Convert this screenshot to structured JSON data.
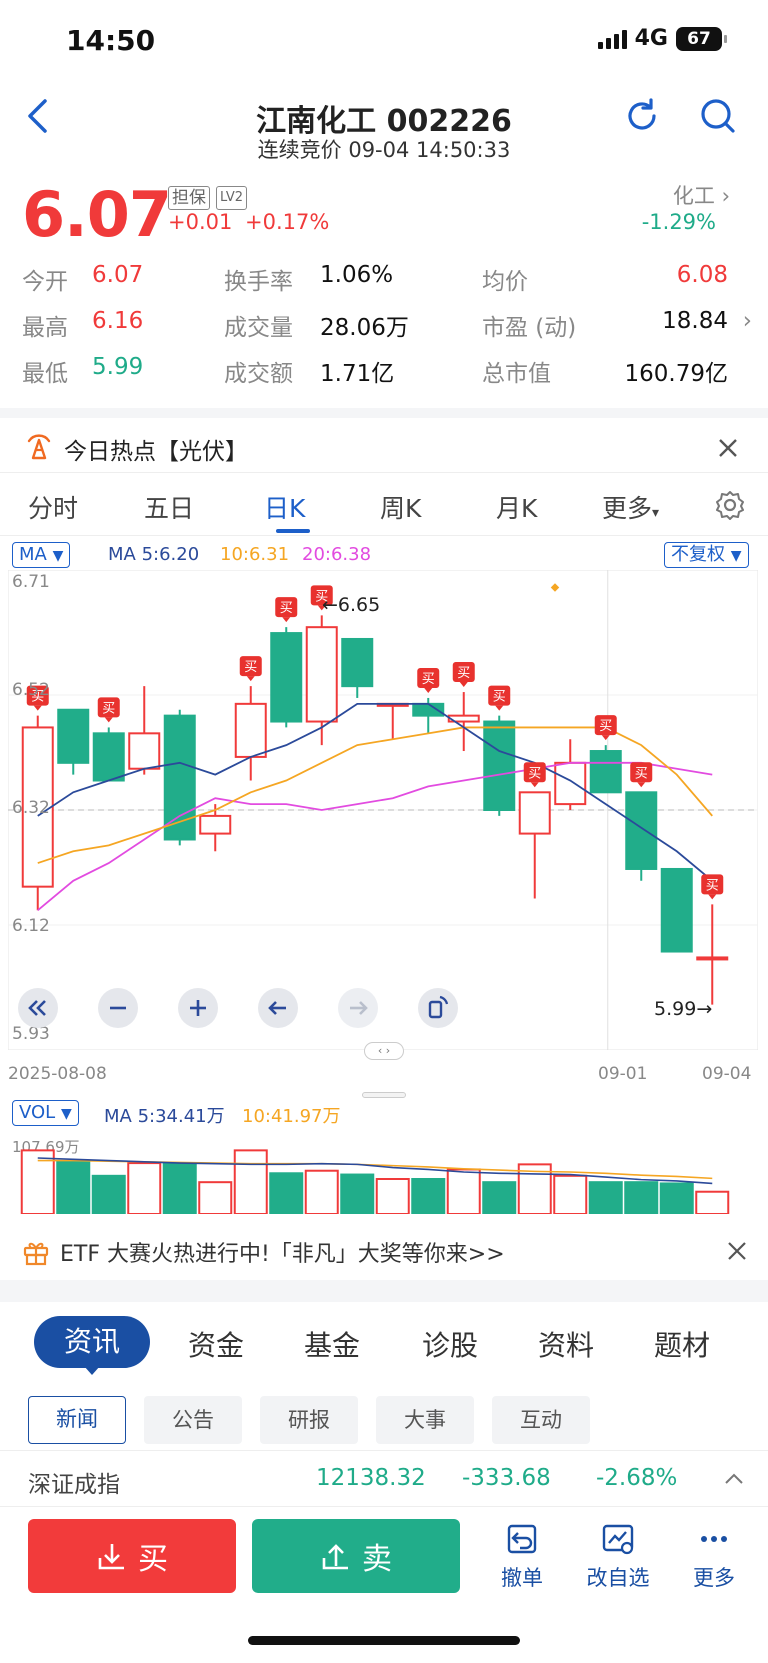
{
  "status": {
    "time": "14:50",
    "network": "4G",
    "battery": "67"
  },
  "header": {
    "title": "江南化工 002226",
    "subtitle": "连续竞价 09-04 14:50:33"
  },
  "quote": {
    "price": "6.07",
    "tag_margin": "担保",
    "tag_level": "LV2",
    "change": "+0.01",
    "change_pct": "+0.17%",
    "industry_name": "化工",
    "industry_pct": "-1.29%"
  },
  "stats": {
    "open_label": "今开",
    "open": "6.07",
    "high_label": "最高",
    "high": "6.16",
    "low_label": "最低",
    "low": "5.99",
    "turnover_label": "换手率",
    "turnover": "1.06%",
    "volume_label": "成交量",
    "volume": "28.06万",
    "amount_label": "成交额",
    "amount": "1.71亿",
    "avg_label": "均价",
    "avg": "6.08",
    "pe_label": "市盈 (动)",
    "pe": "18.84",
    "mktcap_label": "总市值",
    "mktcap": "160.79亿"
  },
  "hot_topic": "今日热点【光伏】",
  "period_tabs": [
    "分时",
    "五日",
    "日K",
    "周K",
    "月K",
    "更多"
  ],
  "ma_legend": {
    "selector": "MA",
    "ma5": "MA 5:6.20",
    "ma10": "10:6.31",
    "ma20": "20:6.38",
    "adjust": "不复权"
  },
  "vol_legend": {
    "selector": "VOL",
    "ma5": "MA 5:34.41万",
    "ma10": "10:41.97万",
    "max_label": "107.69万"
  },
  "chart_controls": [
    "rewind-icon",
    "zoom-out-icon",
    "zoom-in-icon",
    "prev-icon",
    "next-icon",
    "rotate-icon"
  ],
  "buy_marker": "买",
  "chart_data": {
    "type": "candlestick",
    "y_ticks": [
      "6.71",
      "6.52",
      "6.32",
      "6.12",
      "5.93"
    ],
    "ylim": [
      5.93,
      6.71
    ],
    "x_tick_labels": [
      "2025-08-08",
      "09-01",
      "09-04"
    ],
    "high_annotation": "6.65",
    "low_annotation": "5.99",
    "candles": [
      {
        "o": 6.19,
        "c": 6.46,
        "h": 6.48,
        "l": 6.15
      },
      {
        "o": 6.49,
        "c": 6.4,
        "h": 6.49,
        "l": 6.38
      },
      {
        "o": 6.45,
        "c": 6.37,
        "h": 6.46,
        "l": 6.37
      },
      {
        "o": 6.39,
        "c": 6.45,
        "h": 6.53,
        "l": 6.38
      },
      {
        "o": 6.48,
        "c": 6.27,
        "h": 6.49,
        "l": 6.26
      },
      {
        "o": 6.28,
        "c": 6.31,
        "h": 6.33,
        "l": 6.25
      },
      {
        "o": 6.41,
        "c": 6.5,
        "h": 6.53,
        "l": 6.37
      },
      {
        "o": 6.62,
        "c": 6.47,
        "h": 6.63,
        "l": 6.46
      },
      {
        "o": 6.47,
        "c": 6.63,
        "h": 6.65,
        "l": 6.43
      },
      {
        "o": 6.61,
        "c": 6.53,
        "h": 6.61,
        "l": 6.51
      },
      {
        "o": 6.5,
        "c": 6.5,
        "h": 6.5,
        "l": 6.44
      },
      {
        "o": 6.5,
        "c": 6.48,
        "h": 6.51,
        "l": 6.45
      },
      {
        "o": 6.47,
        "c": 6.48,
        "h": 6.52,
        "l": 6.42
      },
      {
        "o": 6.47,
        "c": 6.32,
        "h": 6.48,
        "l": 6.31
      },
      {
        "o": 6.28,
        "c": 6.35,
        "h": 6.35,
        "l": 6.17
      },
      {
        "o": 6.33,
        "c": 6.4,
        "h": 6.44,
        "l": 6.32
      },
      {
        "o": 6.42,
        "c": 6.35,
        "h": 6.43,
        "l": 6.35
      },
      {
        "o": 6.35,
        "c": 6.22,
        "h": 6.35,
        "l": 6.2
      },
      {
        "o": 6.22,
        "c": 6.08,
        "h": 6.22,
        "l": 6.08
      },
      {
        "o": 6.07,
        "c": 6.07,
        "h": 6.16,
        "l": 5.99
      }
    ],
    "ma5": [
      6.31,
      6.35,
      6.37,
      6.39,
      6.4,
      6.38,
      6.41,
      6.43,
      6.46,
      6.5,
      6.5,
      6.5,
      6.46,
      6.42,
      6.4,
      6.37,
      6.33,
      6.29,
      6.25,
      6.2
    ],
    "ma10": [
      6.23,
      6.25,
      6.26,
      6.28,
      6.3,
      6.32,
      6.35,
      6.37,
      6.4,
      6.43,
      6.44,
      6.45,
      6.46,
      6.46,
      6.46,
      6.46,
      6.46,
      6.43,
      6.38,
      6.31
    ],
    "ma20": [
      6.15,
      6.2,
      6.23,
      6.27,
      6.31,
      6.34,
      6.33,
      6.33,
      6.32,
      6.33,
      6.34,
      6.36,
      6.37,
      6.38,
      6.39,
      6.4,
      6.4,
      6.4,
      6.39,
      6.38
    ],
    "buy_marks": [
      0,
      2,
      6,
      7,
      8,
      11,
      12,
      13,
      14,
      16,
      17,
      19
    ],
    "volume": [
      100,
      82,
      60,
      80,
      80,
      50,
      100,
      64,
      68,
      62,
      55,
      55,
      70,
      50,
      78,
      60,
      50,
      50,
      48,
      35
    ],
    "vol_ma5": [
      88,
      86,
      84,
      82,
      80,
      79,
      78,
      78,
      79,
      78,
      73,
      70,
      66,
      64,
      63,
      62,
      58,
      54,
      52,
      48
    ],
    "vol_ma10": [
      84,
      84,
      83,
      82,
      81,
      80,
      79,
      79,
      79,
      78,
      76,
      74,
      71,
      69,
      67,
      66,
      64,
      61,
      59,
      56
    ]
  },
  "etf_banner": "ETF 大赛火热进行中!「非凡」大奖等你来>>",
  "info_tabs": [
    "资讯",
    "资金",
    "基金",
    "诊股",
    "资料",
    "题材"
  ],
  "sub_tabs": [
    "新闻",
    "公告",
    "研报",
    "大事",
    "互动"
  ],
  "index_row": {
    "name": "深证成指",
    "value": "12138.32",
    "change": "-333.68",
    "pct": "-2.68%"
  },
  "bottom_bar": {
    "buy": "买",
    "sell": "卖",
    "cancel": "撤单",
    "watchlist": "改自选",
    "more": "更多"
  }
}
